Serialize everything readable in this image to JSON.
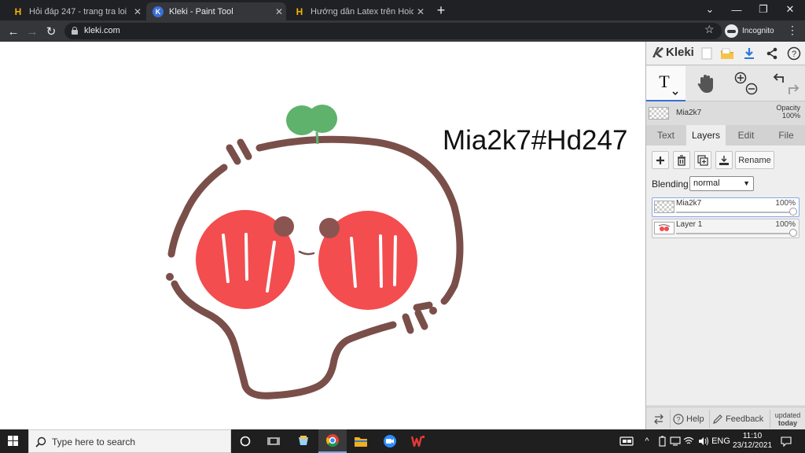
{
  "browser": {
    "tabs": [
      {
        "title": "Hỏi đáp 247 - trang tra loi",
        "icon": "hoidap-favicon",
        "active": false
      },
      {
        "title": "Kleki - Paint Tool",
        "icon": "kleki-favicon",
        "active": true
      },
      {
        "title": "Hướng dẫn Latex trên Hoidap247",
        "icon": "hoidap-favicon",
        "active": false
      }
    ],
    "url": "kleki.com",
    "profile_label": "Incognito"
  },
  "canvas": {
    "text": "Mia2k7#Hd247",
    "colors": {
      "outline": "#7a4f4a",
      "cheeks": "#f34d4f",
      "eyes": "#8a5550",
      "sprout": "#5fb26b"
    }
  },
  "kleki": {
    "logo_text": "Kleki",
    "current_layer_name": "Mia2k7",
    "opacity_label": "Opacity",
    "opacity_value": "100%",
    "tabs": [
      "Text",
      "Layers",
      "Edit",
      "File"
    ],
    "active_tab": "Layers",
    "rename_label": "Rename",
    "blending_label": "Blending",
    "blending_value": "normal",
    "layers": [
      {
        "name": "Mia2k7",
        "opacity": "100%",
        "selected": true
      },
      {
        "name": "Layer 1",
        "opacity": "100%",
        "selected": false
      }
    ],
    "bottom": {
      "help_label": "Help",
      "feedback_label": "Feedback",
      "updated_line1": "updated",
      "updated_line2": "today"
    }
  },
  "taskbar": {
    "search_placeholder": "Type here to search",
    "language": "ENG",
    "time": "11:10",
    "date": "23/12/2021"
  }
}
